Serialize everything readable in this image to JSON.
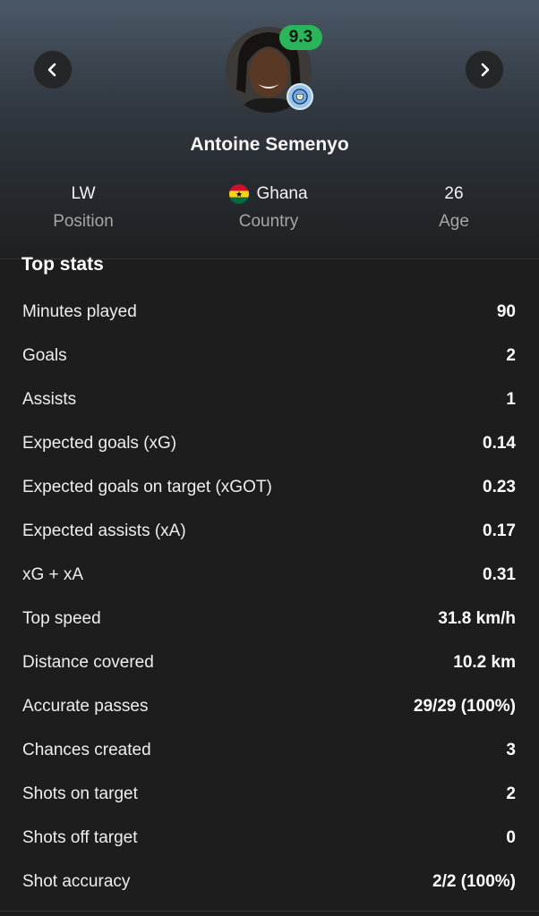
{
  "player": {
    "name": "Antoine Semenyo",
    "rating": "9.3",
    "rating_color": "#2bb55a",
    "club_badge_icon": "manchester-city-badge-icon"
  },
  "info": [
    {
      "value": "LW",
      "label": "Position"
    },
    {
      "value": "Ghana",
      "label": "Country",
      "icon": "ghana-flag-icon"
    },
    {
      "value": "26",
      "label": "Age"
    }
  ],
  "section": {
    "title": "Top stats"
  },
  "stats": [
    {
      "label": "Minutes played",
      "value": "90"
    },
    {
      "label": "Goals",
      "value": "2"
    },
    {
      "label": "Assists",
      "value": "1"
    },
    {
      "label": "Expected goals (xG)",
      "value": "0.14"
    },
    {
      "label": "Expected goals on target (xGOT)",
      "value": "0.23"
    },
    {
      "label": "Expected assists (xA)",
      "value": "0.17"
    },
    {
      "label": "xG + xA",
      "value": "0.31"
    },
    {
      "label": "Top speed",
      "value": "31.8 km/h"
    },
    {
      "label": "Distance covered",
      "value": "10.2 km"
    },
    {
      "label": "Accurate passes",
      "value": "29/29 (100%)"
    },
    {
      "label": "Chances created",
      "value": "3"
    },
    {
      "label": "Shots on target",
      "value": "2"
    },
    {
      "label": "Shots off target",
      "value": "0"
    },
    {
      "label": "Shot accuracy",
      "value": "2/2 (100%)"
    }
  ],
  "nav": {
    "prev_icon": "chevron-left-icon",
    "next_icon": "chevron-right-icon"
  }
}
